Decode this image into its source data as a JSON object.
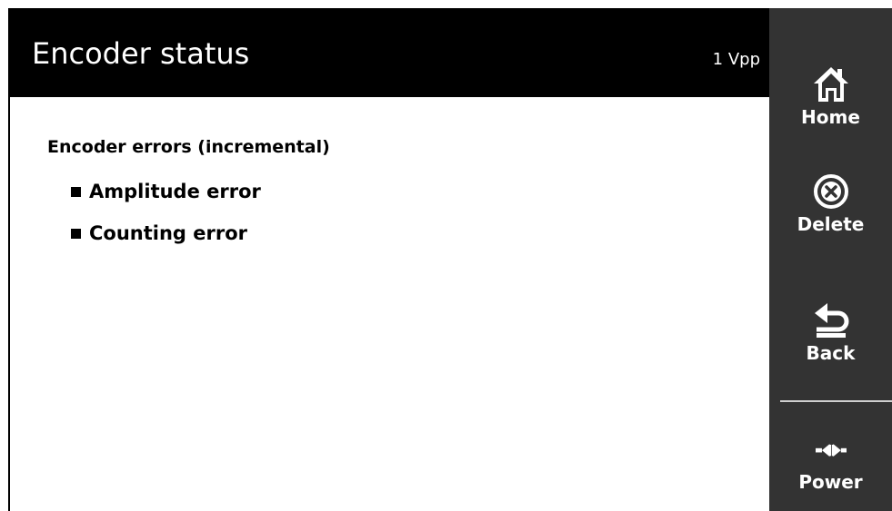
{
  "header": {
    "title": "Encoder status",
    "interface": "1 Vpp"
  },
  "content": {
    "group_title": "Encoder errors (incremental)",
    "errors": [
      {
        "label": "Amplitude error"
      },
      {
        "label": "Counting error"
      }
    ]
  },
  "sidebar": {
    "home_label": "Home",
    "delete_label": "Delete",
    "back_label": "Back",
    "power_label": "Power"
  },
  "colors": {
    "header_bg": "#000000",
    "sidebar_bg": "#333333",
    "text": "#000000",
    "sidebar_text": "#ffffff"
  },
  "icons": [
    "home-icon",
    "delete-icon",
    "back-icon",
    "power-icon"
  ]
}
